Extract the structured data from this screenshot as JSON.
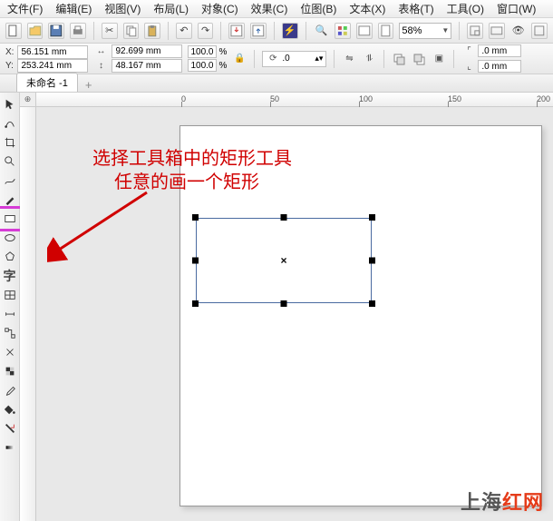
{
  "menu": {
    "file": "文件(F)",
    "edit": "编辑(E)",
    "view": "视图(V)",
    "layout": "布局(L)",
    "object": "对象(C)",
    "effect": "效果(C)",
    "bitmap": "位图(B)",
    "text": "文本(X)",
    "table": "表格(T)",
    "tools": "工具(O)",
    "window": "窗口(W)"
  },
  "toolbar": {
    "zoom": "58%"
  },
  "props": {
    "x_label": "X:",
    "x_value": "56.151 mm",
    "y_label": "Y:",
    "y_value": "253.241 mm",
    "w_value": "92.699 mm",
    "h_value": "48.167 mm",
    "scale_x": "100.0",
    "scale_y": "100.0",
    "pct": "%",
    "angle": ".0",
    "outline1": ".0 mm",
    "outline2": ".0 mm"
  },
  "tab": {
    "name": "未命名 -1",
    "add": "+"
  },
  "ruler": {
    "t0": "0",
    "t50": "50",
    "t100": "100",
    "t150": "150",
    "t200": "200"
  },
  "annotation": {
    "line1": "选择工具箱中的矩形工具",
    "line2": "任意的画一个矩形"
  },
  "center_mark": "×",
  "watermark": {
    "part1": "上海",
    "part2": "红网"
  }
}
